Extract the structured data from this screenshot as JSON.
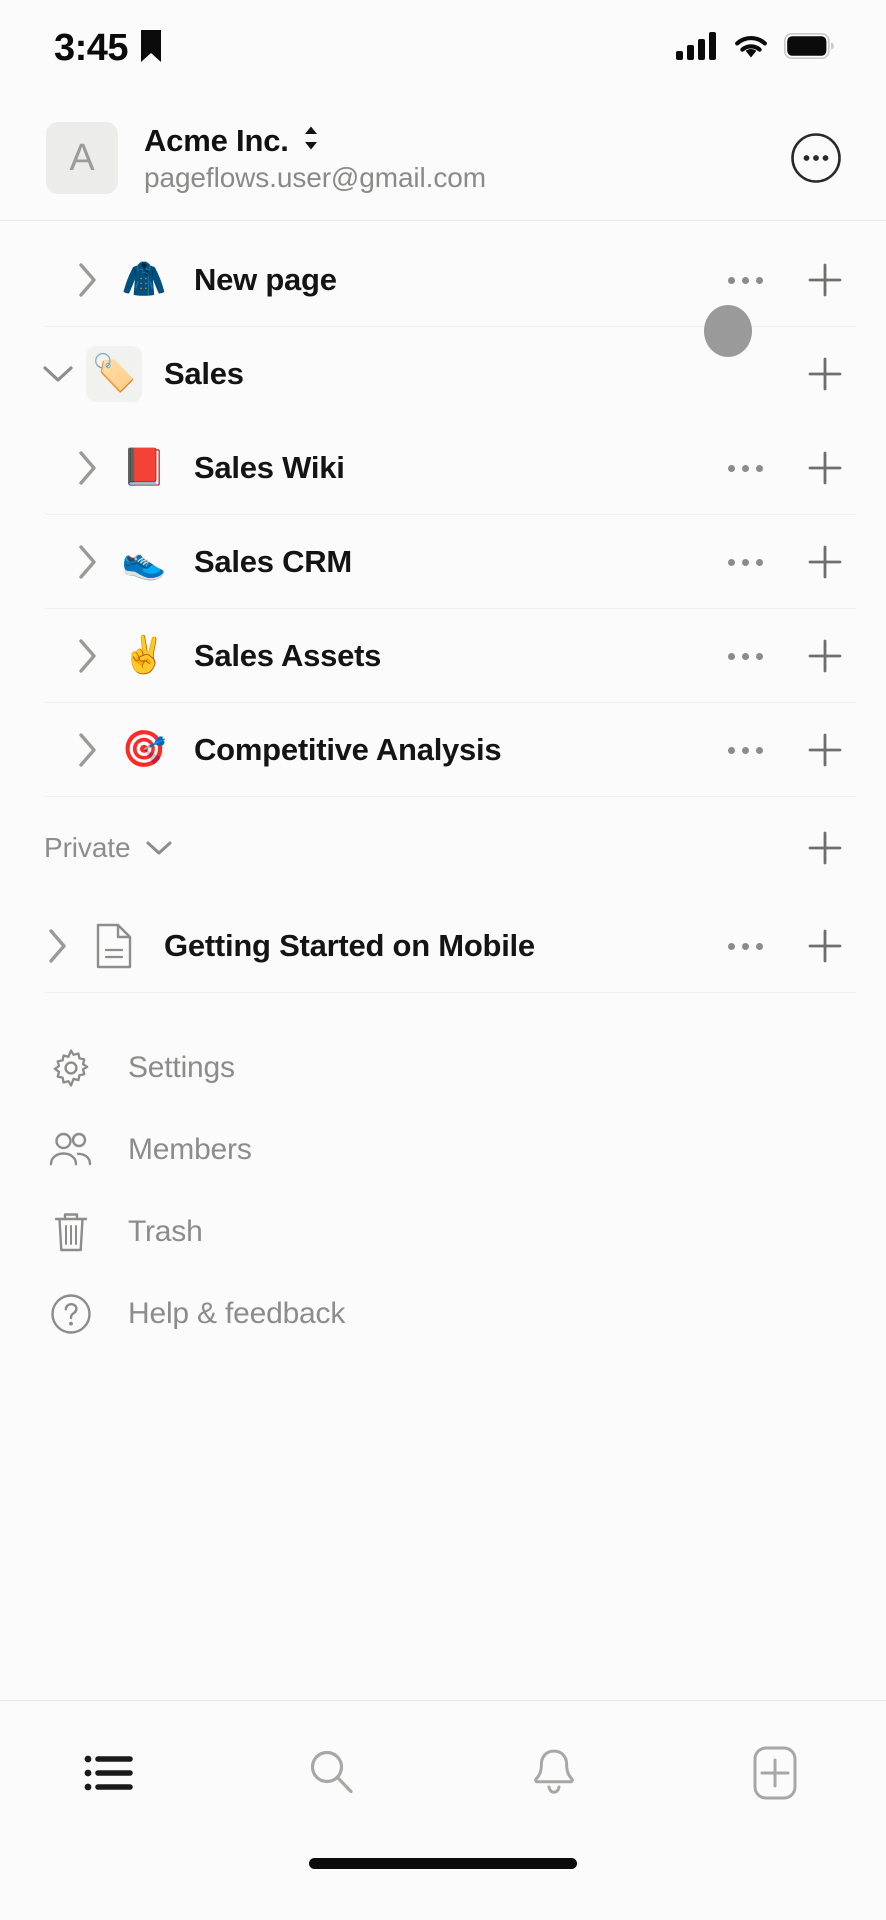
{
  "status_bar": {
    "time": "3:45",
    "bookmark_icon": "bookmark-icon",
    "cellular_icon": "cellular-signal-icon",
    "wifi_icon": "wifi-icon",
    "battery_icon": "battery-icon"
  },
  "workspace": {
    "avatar_letter": "A",
    "name": "Acme Inc.",
    "switcher_icon": "chevron-up-down-icon",
    "email": "pageflows.user@gmail.com",
    "more_icon": "more-circle-icon"
  },
  "tree": {
    "items": [
      {
        "title": "New page",
        "emoji": "🧥",
        "emoji_name": "coat-hanger-emoji",
        "expanded": false,
        "indent": "lvl0",
        "boxed_emoji": false,
        "has_more": true,
        "has_add": true,
        "touch_indicator": true
      },
      {
        "title": "Sales",
        "emoji": "🏷️",
        "emoji_name": "label-tag-emoji",
        "expanded": true,
        "indent": "lvl0b",
        "boxed_emoji": true,
        "has_more": false,
        "has_add": true,
        "touch_indicator": false
      },
      {
        "title": "Sales Wiki",
        "emoji": "📕",
        "emoji_name": "closed-book-emoji",
        "expanded": false,
        "indent": "lvl1",
        "boxed_emoji": false,
        "has_more": true,
        "has_add": true,
        "touch_indicator": false
      },
      {
        "title": "Sales CRM",
        "emoji": "👟",
        "emoji_name": "running-shoe-emoji",
        "expanded": false,
        "indent": "lvl1",
        "boxed_emoji": false,
        "has_more": true,
        "has_add": true,
        "touch_indicator": false
      },
      {
        "title": "Sales Assets",
        "emoji": "✌️",
        "emoji_name": "victory-hand-emoji",
        "expanded": false,
        "indent": "lvl1",
        "boxed_emoji": false,
        "has_more": true,
        "has_add": true,
        "touch_indicator": false
      },
      {
        "title": "Competitive Analysis",
        "emoji": "🎯",
        "emoji_name": "bullseye-dart-emoji",
        "expanded": false,
        "indent": "lvl1",
        "boxed_emoji": false,
        "has_more": true,
        "has_add": true,
        "touch_indicator": false
      }
    ]
  },
  "private_section": {
    "label": "Private",
    "chevron_icon": "chevron-down-icon",
    "add_icon": "plus-icon",
    "items": [
      {
        "title": "Getting Started on Mobile",
        "icon_name": "document-page-icon",
        "expanded": false,
        "has_more": true,
        "has_add": true
      }
    ]
  },
  "utility_menu": {
    "items": [
      {
        "label": "Settings",
        "icon": "gear-icon"
      },
      {
        "label": "Members",
        "icon": "people-icon"
      },
      {
        "label": "Trash",
        "icon": "trash-icon"
      },
      {
        "label": "Help & feedback",
        "icon": "question-circle-icon"
      }
    ]
  },
  "tab_bar": {
    "tabs": [
      {
        "name": "sidebar-list-tab",
        "icon": "bullet-list-icon",
        "active": true
      },
      {
        "name": "search-tab",
        "icon": "search-icon",
        "active": false
      },
      {
        "name": "notifications-tab",
        "icon": "bell-icon",
        "active": false
      },
      {
        "name": "new-page-tab",
        "icon": "new-page-plus-icon",
        "active": false
      }
    ]
  },
  "colors": {
    "background": "#fbfbfb",
    "text_primary": "#141414",
    "text_muted": "#8c8c8a",
    "divider": "#efefed",
    "active_tab": "#1a1a1a",
    "inactive_tab": "#a7a7a5",
    "touch_indicator": "#9a9a9a"
  }
}
